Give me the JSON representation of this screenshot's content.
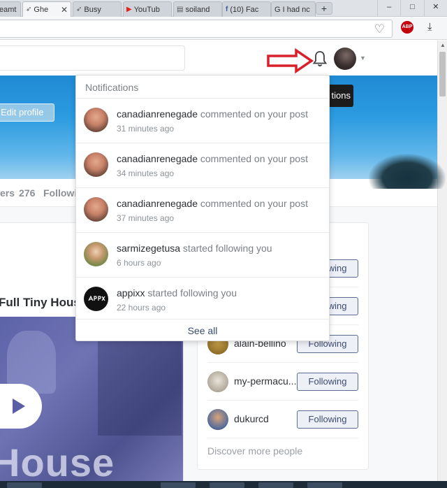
{
  "browser": {
    "tabs": [
      {
        "label": "eamt",
        "active": false,
        "icon": "feather-icon"
      },
      {
        "label": "Ghe",
        "active": true,
        "icon": "feather-icon"
      },
      {
        "label": "Busy",
        "active": false,
        "icon": "feather-icon"
      },
      {
        "label": "YouTub",
        "active": false,
        "icon": "youtube-icon"
      },
      {
        "label": "soiland",
        "active": false,
        "icon": "page-icon"
      },
      {
        "label": "(10) Fac",
        "active": false,
        "icon": "facebook-icon"
      },
      {
        "label": "G I had nc",
        "active": false,
        "icon": "google-icon"
      }
    ],
    "new_tab_symbol": "+",
    "tab_close_symbol": "✕",
    "adblock_label": "ABP"
  },
  "profile": {
    "edit_button": "Edit profile",
    "hero_chip": "tions",
    "followers_label": "ers",
    "followers_count": "276",
    "following_label": "Followi"
  },
  "post": {
    "title": "Full Tiny House",
    "media_text": "House"
  },
  "people": {
    "rows": [
      {
        "name": "",
        "button": "Following"
      },
      {
        "name": "",
        "button": "Following"
      },
      {
        "name": "alain-bellino",
        "button": "Following"
      },
      {
        "name": "my-permacu...",
        "button": "Following"
      },
      {
        "name": "dukurcd",
        "button": "Following"
      }
    ],
    "discover_link": "Discover more people"
  },
  "notifications": {
    "header": "Notifications",
    "items": [
      {
        "user": "canadianrenegade",
        "action": " commented on your post",
        "time": "31 minutes ago"
      },
      {
        "user": "canadianrenegade",
        "action": " commented on your post",
        "time": "34 minutes ago"
      },
      {
        "user": "canadianrenegade",
        "action": " commented on your post",
        "time": "37 minutes ago"
      },
      {
        "user": "sarmizegetusa",
        "action": " started following you",
        "time": "6 hours ago"
      },
      {
        "user": "appixx",
        "action": " started following you",
        "time": "22 hours ago"
      }
    ],
    "see_all": "See all"
  },
  "colors": {
    "annotation_arrow": "#d8202c",
    "follow_button_border": "#5b6c8f",
    "hero_blue": "#2c9be0"
  }
}
